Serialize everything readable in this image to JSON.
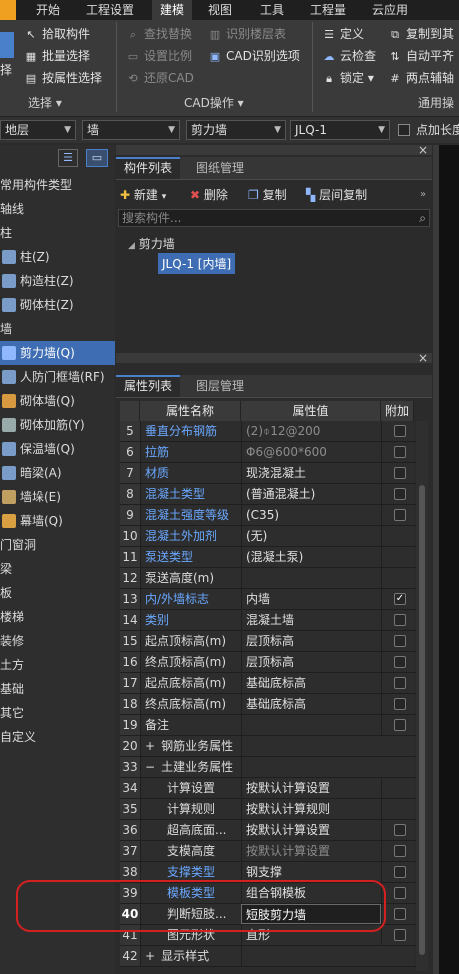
{
  "menu": {
    "tabs": [
      "开始",
      "工程设置",
      "建模",
      "视图",
      "工具",
      "工程量",
      "云应用"
    ],
    "active": "建模"
  },
  "ribbon": {
    "select_group": {
      "label": "选择",
      "big_label": "择",
      "items": [
        "拾取构件",
        "批量选择",
        "按属性选择"
      ]
    },
    "cad_group": {
      "label": "CAD操作",
      "items": [
        "查找替换",
        "设置比例",
        "还原CAD",
        "识别楼层表",
        "CAD识别选项"
      ]
    },
    "general_group": {
      "label": "通用操",
      "items": [
        "定义",
        "云检查",
        "锁定",
        "复制到其",
        "自动平齐",
        "两点辅轴"
      ]
    }
  },
  "filter": {
    "floor": "地层",
    "category": "墙",
    "type": "剪力墙",
    "component": "JLQ-1",
    "checkbox_label": "点加长度"
  },
  "leftnav": {
    "items": [
      {
        "label": "常用构件类型",
        "kind": "group"
      },
      {
        "label": "轴线",
        "kind": "group"
      },
      {
        "label": "柱",
        "kind": "group"
      },
      {
        "label": "柱(Z)",
        "kind": "sub",
        "icon": "column-icon"
      },
      {
        "label": "构造柱(Z)",
        "kind": "sub",
        "icon": "structural-column-icon"
      },
      {
        "label": "砌体柱(Z)",
        "kind": "sub",
        "icon": "masonry-column-icon"
      },
      {
        "label": "墙",
        "kind": "group"
      },
      {
        "label": "剪力墙(Q)",
        "kind": "sub",
        "icon": "shear-wall-icon",
        "selected": true
      },
      {
        "label": "人防门框墙(RF)",
        "kind": "sub",
        "icon": "civil-defense-wall-icon"
      },
      {
        "label": "砌体墙(Q)",
        "kind": "sub",
        "icon": "masonry-wall-icon"
      },
      {
        "label": "砌体加筋(Y)",
        "kind": "sub",
        "icon": "masonry-rebar-icon"
      },
      {
        "label": "保温墙(Q)",
        "kind": "sub",
        "icon": "insulation-wall-icon"
      },
      {
        "label": "暗梁(A)",
        "kind": "sub",
        "icon": "hidden-beam-icon"
      },
      {
        "label": "墙垛(E)",
        "kind": "sub",
        "icon": "wall-buttress-icon"
      },
      {
        "label": "幕墙(Q)",
        "kind": "sub",
        "icon": "curtain-wall-icon"
      },
      {
        "label": "门窗洞",
        "kind": "group"
      },
      {
        "label": "梁",
        "kind": "group"
      },
      {
        "label": "板",
        "kind": "group"
      },
      {
        "label": "楼梯",
        "kind": "group"
      },
      {
        "label": "装修",
        "kind": "group"
      },
      {
        "label": "土方",
        "kind": "group"
      },
      {
        "label": "基础",
        "kind": "group"
      },
      {
        "label": "其它",
        "kind": "group"
      },
      {
        "label": "自定义",
        "kind": "group"
      }
    ]
  },
  "component_panel": {
    "tabs": [
      "构件列表",
      "图纸管理"
    ],
    "toolbar": [
      "新建",
      "删除",
      "复制",
      "层间复制"
    ],
    "search_placeholder": "搜索构件...",
    "tree_group": "剪力墙",
    "tree_item": "JLQ-1 [内墙]"
  },
  "property_panel": {
    "tabs": [
      "属性列表",
      "图层管理"
    ],
    "headers": [
      "属性名称",
      "属性值",
      "附加"
    ],
    "rows": [
      {
        "num": "5",
        "name": "垂直分布钢筋",
        "value": "(2)⌽12@200",
        "blue": true,
        "gray": true,
        "check": "empty"
      },
      {
        "num": "6",
        "name": "拉筋",
        "value": "Φ6@600*600",
        "blue": true,
        "gray": true,
        "check": "empty"
      },
      {
        "num": "7",
        "name": "材质",
        "value": "现浇混凝土",
        "blue": true,
        "check": "empty"
      },
      {
        "num": "8",
        "name": "混凝土类型",
        "value": "(普通混凝土)",
        "blue": true,
        "check": "empty"
      },
      {
        "num": "9",
        "name": "混凝土强度等级",
        "value": "(C35)",
        "blue": true,
        "check": "empty"
      },
      {
        "num": "10",
        "name": "混凝土外加剂",
        "value": "(无)",
        "blue": true,
        "check": "none"
      },
      {
        "num": "11",
        "name": "泵送类型",
        "value": "(混凝土泵)",
        "blue": true,
        "check": "none"
      },
      {
        "num": "12",
        "name": "泵送高度(m)",
        "value": "",
        "check": "none"
      },
      {
        "num": "13",
        "name": "内/外墙标志",
        "value": "内墙",
        "blue": true,
        "check": "checked"
      },
      {
        "num": "14",
        "name": "类别",
        "value": "混凝土墙",
        "blue": true,
        "check": "empty"
      },
      {
        "num": "15",
        "name": "起点顶标高(m)",
        "value": "层顶标高",
        "check": "empty"
      },
      {
        "num": "16",
        "name": "终点顶标高(m)",
        "value": "层顶标高",
        "check": "empty"
      },
      {
        "num": "17",
        "name": "起点底标高(m)",
        "value": "基础底标高",
        "check": "empty"
      },
      {
        "num": "18",
        "name": "终点底标高(m)",
        "value": "基础底标高",
        "check": "empty"
      },
      {
        "num": "19",
        "name": "备注",
        "value": "",
        "check": "empty"
      },
      {
        "num": "20",
        "name": "钢筋业务属性",
        "value": "",
        "expander": "+",
        "check": "none"
      },
      {
        "num": "33",
        "name": "土建业务属性",
        "value": "",
        "expander": "−",
        "check": "none"
      },
      {
        "num": "34",
        "name": "计算设置",
        "value": "按默认计算设置",
        "indent": true,
        "check": "none"
      },
      {
        "num": "35",
        "name": "计算规则",
        "value": "按默认计算规则",
        "indent": true,
        "check": "none"
      },
      {
        "num": "36",
        "name": "超高底面...",
        "value": "按默认计算设置",
        "indent": true,
        "check": "empty"
      },
      {
        "num": "37",
        "name": "支模高度",
        "value": "按默认计算设置",
        "indent": true,
        "gray": true,
        "check": "empty"
      },
      {
        "num": "38",
        "name": "支撑类型",
        "value": "钢支撑",
        "indent": true,
        "blue": true,
        "check": "empty"
      },
      {
        "num": "39",
        "name": "模板类型",
        "value": "组合钢模板",
        "indent": true,
        "blue": true,
        "check": "empty"
      },
      {
        "num": "40",
        "name": "判断短肢...",
        "value": "短肢剪力墙",
        "indent": true,
        "editing": true,
        "check": "empty"
      },
      {
        "num": "41",
        "name": "图元形状",
        "value": "直形",
        "indent": true,
        "check": "empty"
      },
      {
        "num": "42",
        "name": "显示样式",
        "value": "",
        "expander": "+",
        "check": "none"
      }
    ]
  },
  "colors": {
    "selection": "#3f6db3",
    "blue_text": "#6aa8ff",
    "highlight_ring": "#d32020"
  }
}
